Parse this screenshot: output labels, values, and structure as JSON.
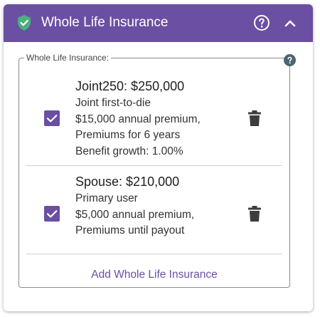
{
  "header": {
    "title": "Whole Life Insurance",
    "shield_icon": "shield-check-icon",
    "help_icon": "help-circle-icon",
    "collapse_icon": "chevron-up-icon"
  },
  "section": {
    "legend": "Whole Life Insurance:",
    "help_icon": "help-icon"
  },
  "items": [
    {
      "title": "Joint250: $250,000",
      "lines": [
        "Joint first-to-die",
        "$15,000 annual premium,",
        "Premiums for 6 years",
        "Benefit growth: 1.00%"
      ],
      "checked": true
    },
    {
      "title": "Spouse: $210,000",
      "lines": [
        "Primary user",
        "$5,000 annual premium,",
        "Premiums until payout"
      ],
      "checked": true
    }
  ],
  "add_label": "Add Whole Life Insurance",
  "colors": {
    "accent": "#6b4fa3",
    "shield": "#4caf7d",
    "help_small": "#4a6572"
  }
}
